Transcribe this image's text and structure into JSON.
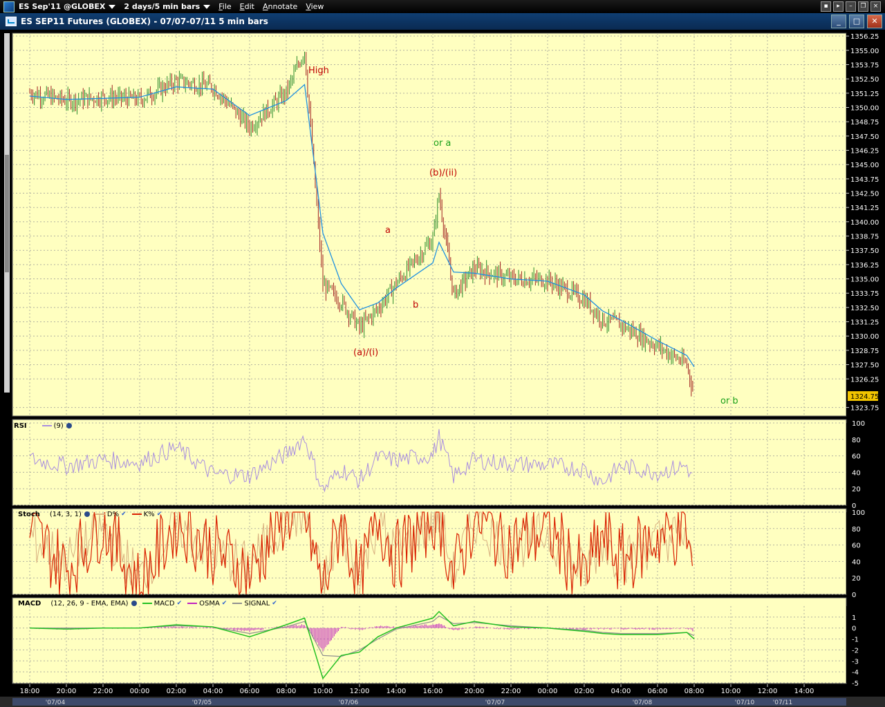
{
  "menubar": {
    "symbol": "ES Sep'11 @GLOBEX",
    "period": "2 days/5 min bars",
    "menus": [
      "File",
      "Edit",
      "Annotate",
      "View"
    ]
  },
  "window": {
    "title": "ES SEP11 Futures (GLOBEX) - 07/07-07/11  5 min bars"
  },
  "price_axis": {
    "ticks": [
      "1356.25",
      "1355.00",
      "1353.75",
      "1352.50",
      "1351.25",
      "1350.00",
      "1348.75",
      "1347.50",
      "1346.25",
      "1345.00",
      "1343.75",
      "1342.50",
      "1341.25",
      "1340.00",
      "1338.75",
      "1337.50",
      "1336.25",
      "1335.00",
      "1333.75",
      "1332.50",
      "1331.25",
      "1330.00",
      "1328.75",
      "1327.50",
      "1326.25",
      "1324.75",
      "1323.75"
    ],
    "last_price": "1324.75",
    "last_price_color": "#f2c400"
  },
  "annotations": [
    {
      "text": "High",
      "color": "#c00000"
    },
    {
      "text": "or a",
      "color": "#1aa01a"
    },
    {
      "text": "(b)/(ii)",
      "color": "#c00000"
    },
    {
      "text": "a",
      "color": "#c00000"
    },
    {
      "text": "b",
      "color": "#c00000"
    },
    {
      "text": "(a)/(i)",
      "color": "#c00000"
    },
    {
      "text": "or b",
      "color": "#1aa01a"
    }
  ],
  "rsi_pane": {
    "name": "RSI",
    "params": "(9)",
    "ticks": [
      "100",
      "80",
      "60",
      "40",
      "20",
      "0"
    ],
    "line_color": "#a88de0"
  },
  "stoch_pane": {
    "name": "Stoch",
    "params": "(14, 3, 1)",
    "d_label": "D%",
    "k_label": "K%",
    "ticks": [
      "100",
      "80",
      "60",
      "40",
      "20",
      "0"
    ],
    "k_color": "#d92000",
    "d_color": "#d9b080"
  },
  "macd_pane": {
    "name": "MACD",
    "params": "(12, 26, 9 - EMA, EMA)",
    "macd_label": "MACD",
    "osma_label": "OSMA",
    "signal_label": "SIGNAL",
    "ticks": [
      "1",
      "0",
      "-1",
      "-2",
      "-3",
      "-4",
      "-5"
    ],
    "macd_color": "#22c022",
    "osma_color": "#c020c0",
    "signal_color": "#909090"
  },
  "time_axis": {
    "hours": [
      "18:00",
      "20:00",
      "22:00",
      "00:00",
      "02:00",
      "04:00",
      "06:00",
      "08:00",
      "10:00",
      "12:00",
      "14:00",
      "16:00",
      "20:00",
      "22:00",
      "00:00",
      "02:00",
      "04:00",
      "06:00",
      "08:00",
      "10:00",
      "12:00",
      "14:00"
    ],
    "dates": [
      "'07/04",
      "'07/05",
      "'07/06",
      "'07/07",
      "'07/08",
      "'07/10",
      "'07/11"
    ]
  },
  "colors": {
    "background": "#ffffc0",
    "grid": "#b0b0a0",
    "bar_up": "#2a8a2a",
    "bar_down": "#a02020",
    "ma_line": "#1e90e0"
  },
  "chart_data": {
    "type": "line",
    "price": {
      "unit": "price",
      "ylim": [
        1323.0,
        1356.5
      ],
      "x": [
        "18:00",
        "20:00",
        "22:00",
        "00:00",
        "02:00",
        "04:00",
        "06:00",
        "08:00",
        "08:30",
        "09:00",
        "10:00",
        "11:00",
        "12:00",
        "14:00",
        "16:00",
        "16:15",
        "17:00",
        "20:00",
        "22:00",
        "00:00",
        "02:00",
        "03:00",
        "04:00",
        "06:00",
        "07:30",
        "08:00"
      ],
      "close": [
        1351.3,
        1350.6,
        1350.9,
        1350.7,
        1352.3,
        1351.8,
        1348.3,
        1351.3,
        1355.0,
        1334.5,
        1333.0,
        1330.7,
        1332.4,
        1334.6,
        1338.5,
        1342.4,
        1333.6,
        1335.9,
        1335.0,
        1334.9,
        1333.2,
        1331.4,
        1331.0,
        1329.1,
        1327.5,
        1324.75
      ],
      "moving_average": [
        1351.0,
        1350.7,
        1350.8,
        1350.9,
        1351.8,
        1351.6,
        1349.3,
        1350.6,
        1352.0,
        1339.0,
        1334.6,
        1332.3,
        1332.9,
        1334.2,
        1336.4,
        1338.2,
        1335.6,
        1335.5,
        1335.0,
        1334.8,
        1333.6,
        1332.2,
        1331.4,
        1329.6,
        1328.3,
        1327.3
      ]
    },
    "rsi": {
      "ylim": [
        0,
        100
      ],
      "values": [
        56,
        48,
        55,
        52,
        70,
        38,
        36,
        62,
        82,
        18,
        44,
        30,
        58,
        55,
        61,
        83,
        35,
        55,
        50,
        49,
        44,
        28,
        48,
        40,
        48,
        27
      ]
    },
    "stoch": {
      "ylim": [
        0,
        100
      ],
      "k": [
        78,
        30,
        88,
        10,
        90,
        55,
        25,
        100,
        98,
        5,
        90,
        10,
        95,
        45,
        95,
        100,
        20,
        95,
        60,
        80,
        20,
        70,
        40,
        70,
        80,
        2
      ],
      "d": [
        70,
        40,
        80,
        20,
        85,
        50,
        35,
        95,
        95,
        10,
        80,
        20,
        90,
        50,
        90,
        95,
        25,
        90,
        55,
        75,
        25,
        65,
        40,
        65,
        75,
        5
      ]
    },
    "macd": {
      "ylim": [
        -5,
        2
      ],
      "macd": [
        0.0,
        -0.1,
        0.0,
        0.0,
        0.3,
        0.1,
        -0.8,
        0.3,
        0.9,
        -4.6,
        -2.5,
        -2.2,
        -0.8,
        0.0,
        0.9,
        1.5,
        0.2,
        0.6,
        0.1,
        0.0,
        -0.3,
        -0.5,
        -0.6,
        -0.6,
        -0.4,
        -1.0
      ],
      "signal": [
        0.0,
        0.0,
        0.0,
        0.0,
        0.2,
        0.1,
        -0.5,
        0.1,
        0.6,
        -2.5,
        -2.6,
        -2.0,
        -1.0,
        -0.1,
        0.6,
        1.1,
        0.4,
        0.5,
        0.2,
        0.0,
        -0.2,
        -0.4,
        -0.5,
        -0.5,
        -0.4,
        -0.7
      ],
      "osma": [
        0.0,
        -0.1,
        0.0,
        0.0,
        0.1,
        0.0,
        -0.3,
        0.2,
        0.3,
        -2.1,
        0.1,
        -0.2,
        0.2,
        0.1,
        0.3,
        0.4,
        -0.2,
        0.1,
        -0.1,
        0.0,
        -0.1,
        -0.1,
        -0.1,
        -0.1,
        0.0,
        -0.3
      ]
    }
  }
}
